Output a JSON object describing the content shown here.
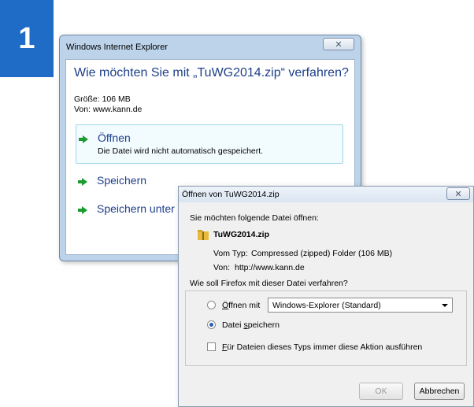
{
  "step": {
    "number": "1",
    "color": "#1f6cc6"
  },
  "ie_dialog": {
    "title": "Windows Internet Explorer",
    "close_icon": "close-icon",
    "close_glyph": "✕",
    "heading": "Wie möchten Sie mit „TuWG2014.zip“ verfahren?",
    "size_line": "Größe: 106 MB",
    "from_line": "Von: www.kann.de",
    "options": [
      {
        "label": "Öffnen",
        "sub": "Die Datei wird nicht automatisch gespeichert."
      },
      {
        "label": "Speichern"
      },
      {
        "label": "Speichern unter"
      }
    ],
    "accent_color": "#1e3f8a",
    "arrow_color": "#1c9b2e"
  },
  "ff_dialog": {
    "title": "Öffnen von TuWG2014.zip",
    "close_glyph": "✕",
    "intro": "Sie möchten folgende Datei öffnen:",
    "filename": "TuWG2014.zip",
    "type_label": "Vom Typ:",
    "type_value": "Compressed (zipped) Folder (106 MB)",
    "from_label": "Von:",
    "from_value": "http://www.kann.de",
    "question": "Wie soll Firefox mit dieser Datei verfahren?",
    "open_with_label_u": "Ö",
    "open_with_label_rest": "ffnen mit",
    "open_with_selected": "Windows-Explorer (Standard)",
    "save_label_a": "Datei ",
    "save_label_u": "s",
    "save_label_b": "peichern",
    "save_checked": true,
    "always_label_u": "F",
    "always_label_rest": "ür Dateien dieses Typs immer diese Aktion ausführen",
    "ok_label": "OK",
    "cancel_label": "Abbrechen"
  }
}
